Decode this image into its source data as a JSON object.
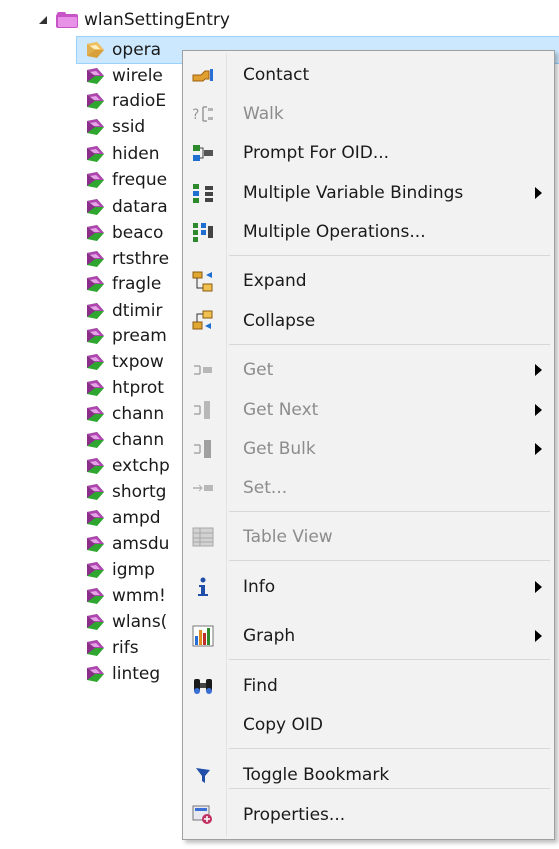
{
  "tree": {
    "root_label": "wlanSettingEntry",
    "items": [
      {
        "label": "opera"
      },
      {
        "label": "wirele"
      },
      {
        "label": "radioE"
      },
      {
        "label": "ssid"
      },
      {
        "label": "hiden"
      },
      {
        "label": "freque"
      },
      {
        "label": "datara"
      },
      {
        "label": "beaco"
      },
      {
        "label": "rtsthre"
      },
      {
        "label": "fragle"
      },
      {
        "label": "dtimir"
      },
      {
        "label": "pream"
      },
      {
        "label": "txpow"
      },
      {
        "label": "htprot"
      },
      {
        "label": "chann"
      },
      {
        "label": "chann"
      },
      {
        "label": "extchp"
      },
      {
        "label": "shortg"
      },
      {
        "label": "ampd"
      },
      {
        "label": "amsdu"
      },
      {
        "label": "igmp"
      },
      {
        "label": "wmm!"
      },
      {
        "label": "wlans("
      },
      {
        "label": "rifs"
      },
      {
        "label": "linteg"
      }
    ]
  },
  "context_menu": {
    "items": [
      {
        "label": "Contact",
        "icon": "contact-hand-icon",
        "enabled": true,
        "submenu": false
      },
      {
        "label": "Walk",
        "icon": "walk-icon",
        "enabled": false,
        "submenu": false
      },
      {
        "label": "Prompt For OID...",
        "icon": "prompt-oid-icon",
        "enabled": true,
        "submenu": false
      },
      {
        "label": "Multiple Variable Bindings",
        "icon": "multi-bindings-icon",
        "enabled": true,
        "submenu": true
      },
      {
        "label": "Multiple Operations...",
        "icon": "multi-operations-icon",
        "enabled": true,
        "submenu": false
      },
      {
        "label": "Expand",
        "icon": "expand-tree-icon",
        "enabled": true,
        "submenu": false
      },
      {
        "label": "Collapse",
        "icon": "collapse-tree-icon",
        "enabled": true,
        "submenu": false
      },
      {
        "label": "Get",
        "icon": "get-icon",
        "enabled": false,
        "submenu": true
      },
      {
        "label": "Get Next",
        "icon": "get-next-icon",
        "enabled": false,
        "submenu": true
      },
      {
        "label": "Get Bulk",
        "icon": "get-bulk-icon",
        "enabled": false,
        "submenu": true
      },
      {
        "label": "Set...",
        "icon": "set-icon",
        "enabled": false,
        "submenu": false
      },
      {
        "label": "Table View",
        "icon": "table-view-icon",
        "enabled": false,
        "submenu": false
      },
      {
        "label": "Info",
        "icon": "info-icon",
        "enabled": true,
        "submenu": true
      },
      {
        "label": "Graph",
        "icon": "graph-icon",
        "enabled": true,
        "submenu": true
      },
      {
        "label": "Find",
        "icon": "binoculars-icon",
        "enabled": true,
        "submenu": false
      },
      {
        "label": "Copy OID",
        "icon": "",
        "enabled": true,
        "submenu": false
      },
      {
        "label": "Toggle Bookmark",
        "icon": "bookmark-flag-icon",
        "enabled": true,
        "submenu": false
      },
      {
        "label": "Properties...",
        "icon": "properties-icon",
        "enabled": true,
        "submenu": false
      }
    ]
  },
  "colors": {
    "selection_bg": "#cce8ff",
    "selection_border": "#99d1ff",
    "menu_bg": "#f2f2f2",
    "disabled_text": "#8c8c8c",
    "leaf_icon_purple": "#b044b0",
    "leaf_icon_green": "#2fa62f",
    "folder_purple": "#c855c8"
  }
}
